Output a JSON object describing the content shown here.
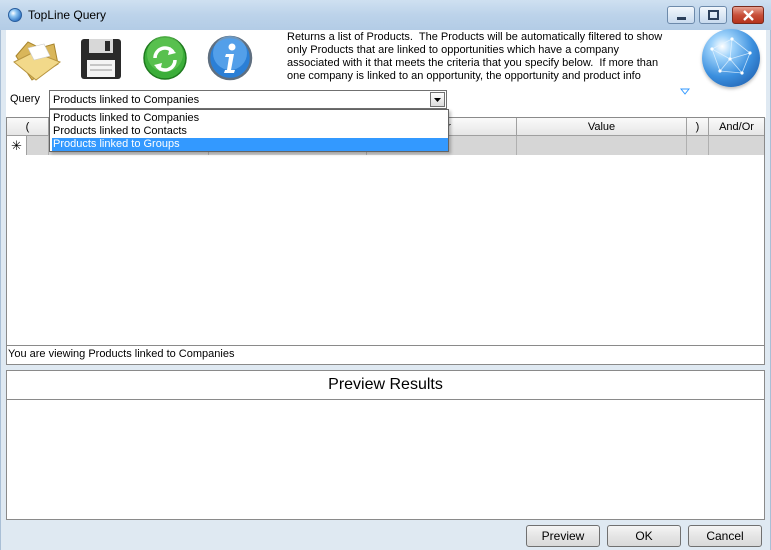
{
  "window": {
    "title": "TopLine Query"
  },
  "toolbar": {
    "icons": [
      "open-folder-icon",
      "save-disk-icon",
      "refresh-icon",
      "info-icon"
    ],
    "description": "Returns a list of Products.  The Products will be automatically filtered to show\nonly Products that are linked to opportunities which have a company\nassociated with it that meets the criteria that you specify below.  If more than\none company is linked to an opportunity, the opportunity and product info",
    "globe_icon": "globe-icon"
  },
  "query": {
    "label": "Query",
    "selected": "Products linked to Companies",
    "options": [
      "Products linked to Companies",
      "Products linked to Contacts",
      "Products linked to Groups"
    ],
    "highlighted_index": 2
  },
  "grid": {
    "columns": [
      "(",
      "",
      "",
      "ator",
      "Value",
      ")",
      "And/Or"
    ],
    "new_row_marker": "✳"
  },
  "status": {
    "text": "You are viewing Products linked to Companies"
  },
  "preview": {
    "title": "Preview Results"
  },
  "buttons": {
    "preview": "Preview",
    "ok": "OK",
    "cancel": "Cancel"
  },
  "colors": {
    "accent_selection": "#3399ff",
    "titlebar": "#bcd3ea",
    "close_button": "#c8503a"
  }
}
